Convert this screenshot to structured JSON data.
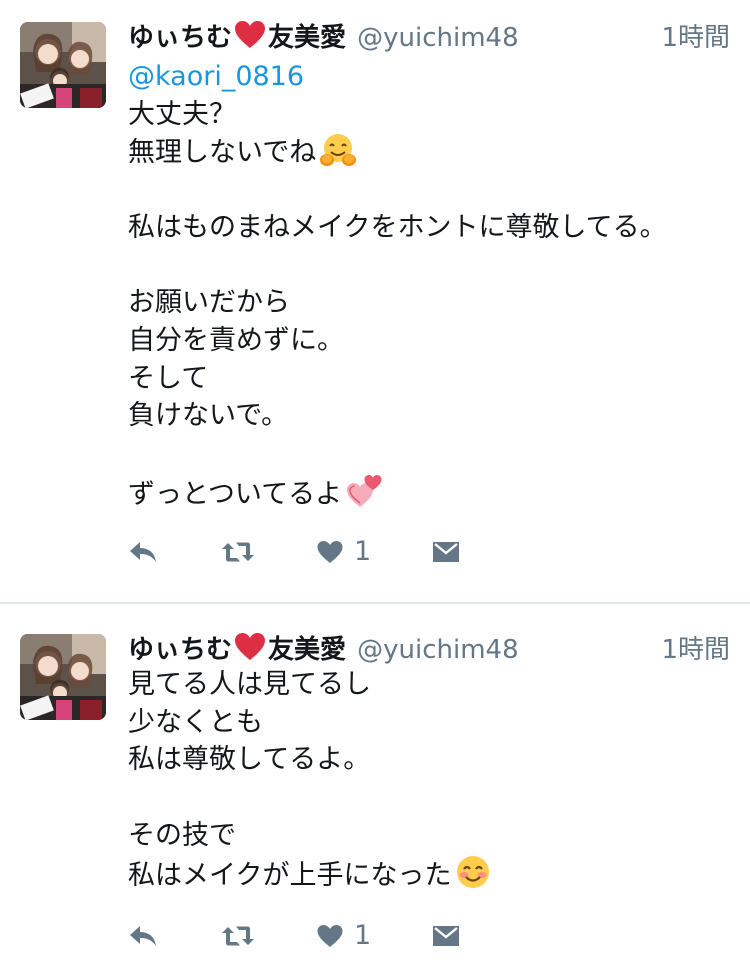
{
  "tweets": [
    {
      "display_name": "ゆぃちむ",
      "display_name_suffix": "友美愛",
      "handle": "@yuichim48",
      "timestamp": "1時間",
      "lines": [
        "@kaori_0816",
        "大丈夫？",
        "無理しないでね",
        "",
        "私はものまねメイクをホントに尊敬してる。",
        "",
        "お願いだから",
        "自分を責めずに。",
        "そして",
        "負けないで。",
        "",
        "ずっとついてるよ"
      ],
      "emojis": [
        "hugging-face",
        "two-hearts"
      ],
      "like_count": "1"
    },
    {
      "display_name": "ゆぃちむ",
      "display_name_suffix": "友美愛",
      "handle": "@yuichim48",
      "timestamp": "1時間",
      "lines": [
        "見てる人は見てるし",
        "少なくとも",
        "私は尊敬してるよ。",
        "",
        "その技で",
        "私はメイクが上手になった"
      ],
      "emojis": [
        "smiling-face-with-smiling-eyes"
      ],
      "like_count": "1"
    }
  ],
  "colors": {
    "text": "#14171a",
    "secondary": "#657786",
    "mention": "#1b95e0",
    "divider": "#e1e8ed",
    "heart": "#e0245e"
  },
  "icons": [
    "reply-icon",
    "retweet-icon",
    "like-icon",
    "direct-message-icon",
    "red-heart-emoji"
  ]
}
